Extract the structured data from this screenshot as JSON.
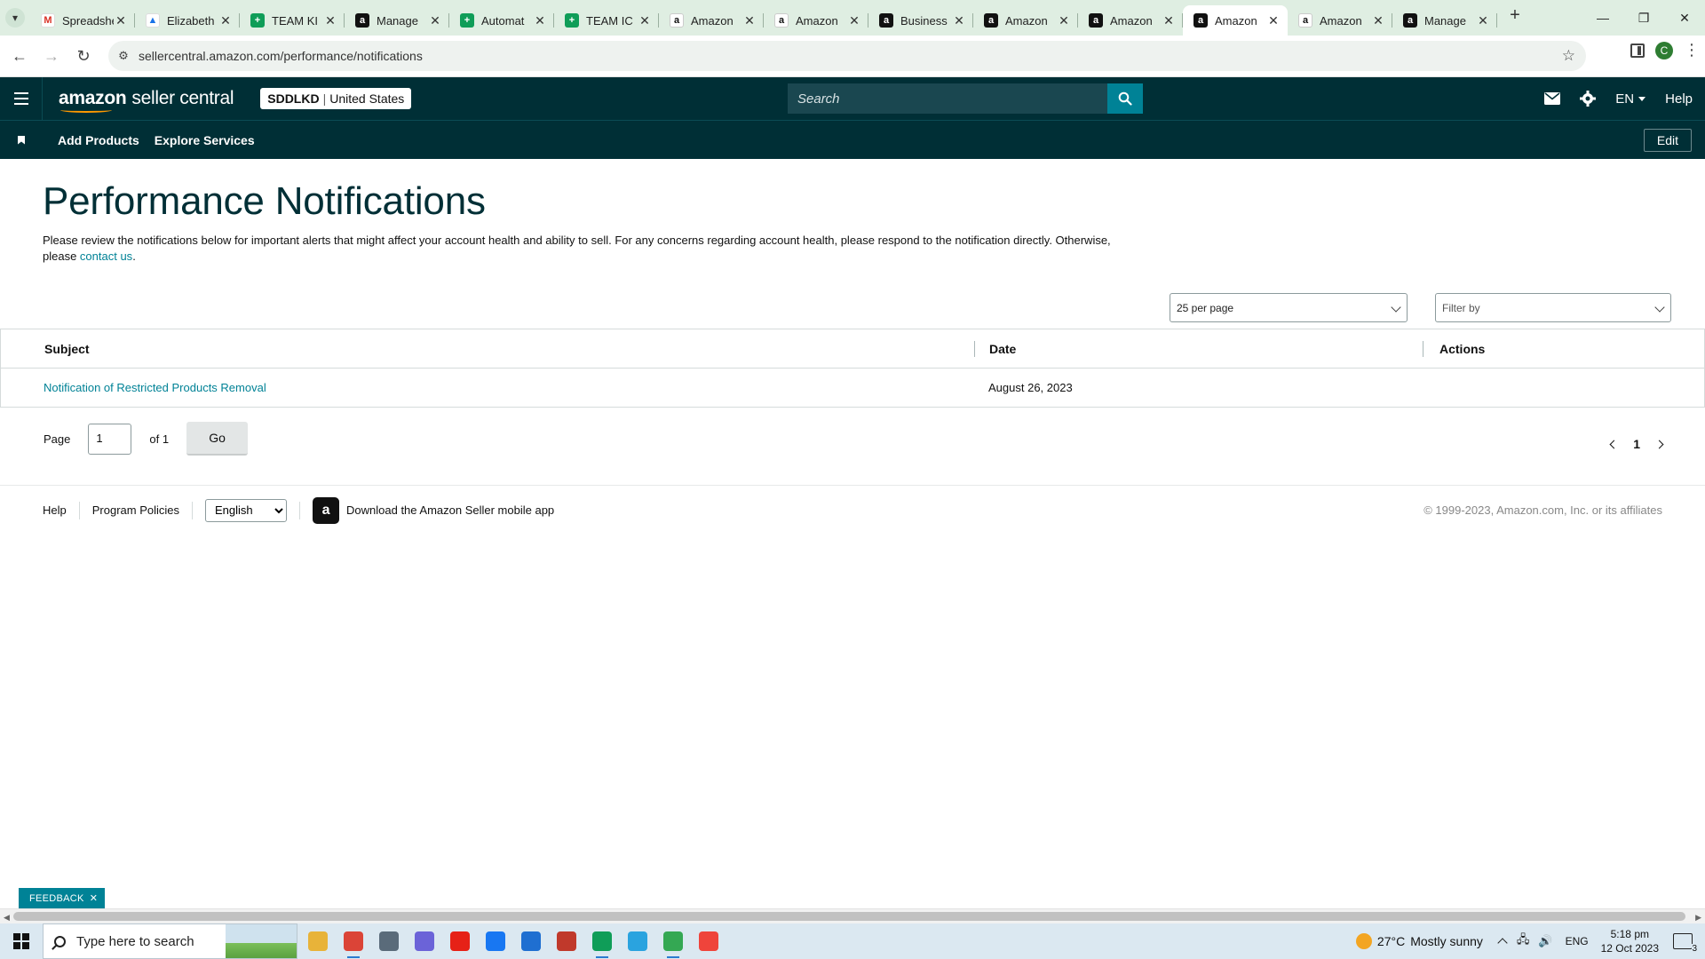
{
  "browser": {
    "tabs": [
      {
        "label": "Spreadsheet",
        "icon": "gmail-icon",
        "fav": "M",
        "kind": "gmail",
        "active": false
      },
      {
        "label": "Elizabeth",
        "icon": "drive-icon",
        "fav": "▲",
        "kind": "drive",
        "active": false
      },
      {
        "label": "TEAM KI",
        "icon": "sheets-icon",
        "fav": "+",
        "kind": "sheets",
        "active": false
      },
      {
        "label": "Manage",
        "icon": "amazon-icon",
        "fav": "a",
        "kind": "amz",
        "active": false
      },
      {
        "label": "Automat",
        "icon": "sheets-icon",
        "fav": "+",
        "kind": "sheets",
        "active": false
      },
      {
        "label": "TEAM IC",
        "icon": "sheets-icon",
        "fav": "+",
        "kind": "sheets",
        "active": false
      },
      {
        "label": "Amazon",
        "icon": "amazon-smile-icon",
        "fav": "a",
        "kind": "amzw",
        "active": false
      },
      {
        "label": "Amazon",
        "icon": "amazon-smile-icon",
        "fav": "a",
        "kind": "amzw",
        "active": false
      },
      {
        "label": "Business",
        "icon": "amazon-icon",
        "fav": "a",
        "kind": "amz",
        "active": false
      },
      {
        "label": "Amazon",
        "icon": "amazon-icon",
        "fav": "a",
        "kind": "amz",
        "active": false
      },
      {
        "label": "Amazon",
        "icon": "amazon-icon",
        "fav": "a",
        "kind": "amz",
        "active": false
      },
      {
        "label": "Amazon",
        "icon": "amazon-icon",
        "fav": "a",
        "kind": "amz",
        "active": true
      },
      {
        "label": "Amazon",
        "icon": "amazon-smile-icon",
        "fav": "a",
        "kind": "amzw",
        "active": false
      },
      {
        "label": "Manage",
        "icon": "amazon-icon",
        "fav": "a",
        "kind": "amz",
        "active": false
      }
    ],
    "url": "sellercentral.amazon.com/performance/notifications",
    "profile_initial": "C"
  },
  "header": {
    "logo_amazon": "amazon",
    "logo_seller_central": "seller central",
    "account_name": "SDDLKD",
    "account_region": "United States",
    "search_placeholder": "Search",
    "language": "EN",
    "help": "Help"
  },
  "subnav": {
    "items": [
      "Add Products",
      "Explore Services"
    ],
    "edit_label": "Edit"
  },
  "main": {
    "title": "Performance Notifications",
    "intro_text": "Please review the notifications below for important alerts that might affect your account health and ability to sell. For any concerns regarding account health, please respond to the notification directly. Otherwise, please ",
    "intro_link": "contact us",
    "intro_end": ".",
    "per_page": "25 per page",
    "filter_by": "Filter by",
    "table": {
      "columns": [
        "Subject",
        "Date",
        "Actions"
      ],
      "rows": [
        {
          "subject": "Notification of Restricted Products Removal",
          "date": "August 26, 2023",
          "actions": ""
        }
      ]
    },
    "pagination": {
      "page_label": "Page",
      "current_page": "1",
      "of_label": "of 1",
      "go_label": "Go",
      "nav_page": "1"
    }
  },
  "footer": {
    "help": "Help",
    "program_policies": "Program Policies",
    "language_selected": "English",
    "app_text": "Download the Amazon Seller mobile app",
    "copyright": "© 1999-2023, Amazon.com, Inc. or its affiliates"
  },
  "feedback_label": "FEEDBACK",
  "taskbar": {
    "search_placeholder": "Type here to search",
    "apps": [
      {
        "name": "file-explorer-icon",
        "color": "#e8b339",
        "running": false
      },
      {
        "name": "chrome-icon",
        "color": "#db4437",
        "running": true
      },
      {
        "name": "calculator-icon",
        "color": "#5a6b7a",
        "running": false
      },
      {
        "name": "copilot-icon",
        "color": "#6b63d8",
        "running": false
      },
      {
        "name": "youtube-icon",
        "color": "#e62117",
        "running": false
      },
      {
        "name": "facebook-icon",
        "color": "#1877f2",
        "running": false
      },
      {
        "name": "store-icon",
        "color": "#1f6fd1",
        "running": false
      },
      {
        "name": "snipping-tool-icon",
        "color": "#c0392b",
        "running": false
      },
      {
        "name": "chrome-profile-icon",
        "color": "#0f9d58",
        "running": true
      },
      {
        "name": "telegram-icon",
        "color": "#2aa3df",
        "running": false
      },
      {
        "name": "chrome-active-icon",
        "color": "#34a853",
        "running": true
      },
      {
        "name": "anydesk-icon",
        "color": "#ef443b",
        "running": false
      }
    ],
    "weather_temp": "27°C",
    "weather_text": "Mostly sunny",
    "tray_lang": "ENG",
    "time": "5:18 pm",
    "date": "12 Oct 2023",
    "notifications": "3"
  }
}
